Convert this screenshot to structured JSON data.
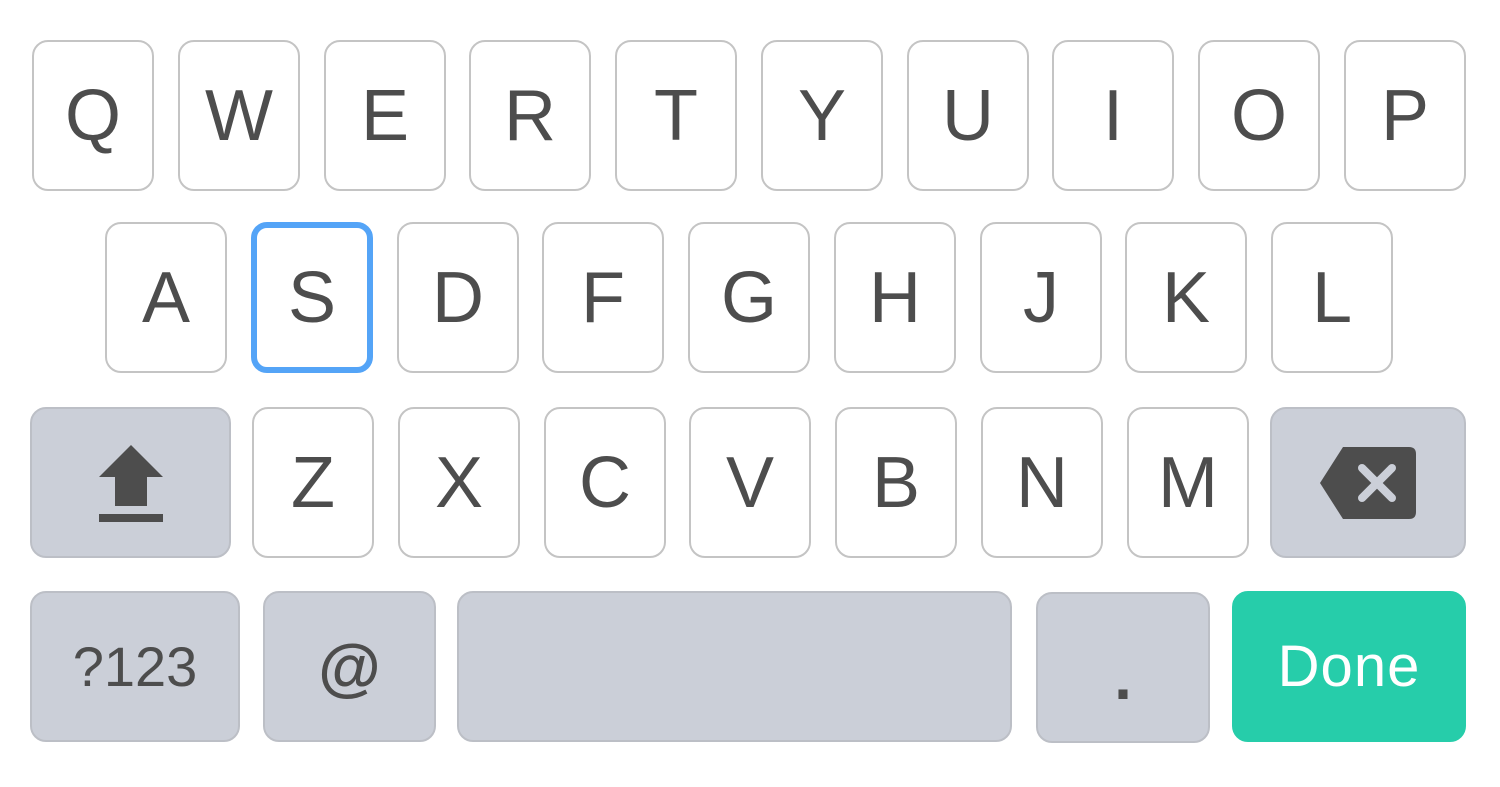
{
  "keyboard": {
    "rows": [
      [
        "Q",
        "W",
        "E",
        "R",
        "T",
        "Y",
        "U",
        "I",
        "O",
        "P"
      ],
      [
        "A",
        "S",
        "D",
        "F",
        "G",
        "H",
        "J",
        "K",
        "L"
      ],
      [
        "Z",
        "X",
        "C",
        "V",
        "B",
        "N",
        "M"
      ]
    ],
    "selected_key": "S",
    "shift_icon": "shift-arrow-icon",
    "backspace_icon": "backspace-icon",
    "symbols_label": "?123",
    "at_label": "@",
    "space_label": "",
    "period_label": ".",
    "done_label": "Done",
    "colors": {
      "key_background": "#ffffff",
      "key_border": "#c4c4c4",
      "function_key_background": "#cbcfd8",
      "text": "#4d4d4d",
      "selected_border": "#54a4f7",
      "done_background": "#26cdaa",
      "done_text": "#ffffff"
    }
  }
}
